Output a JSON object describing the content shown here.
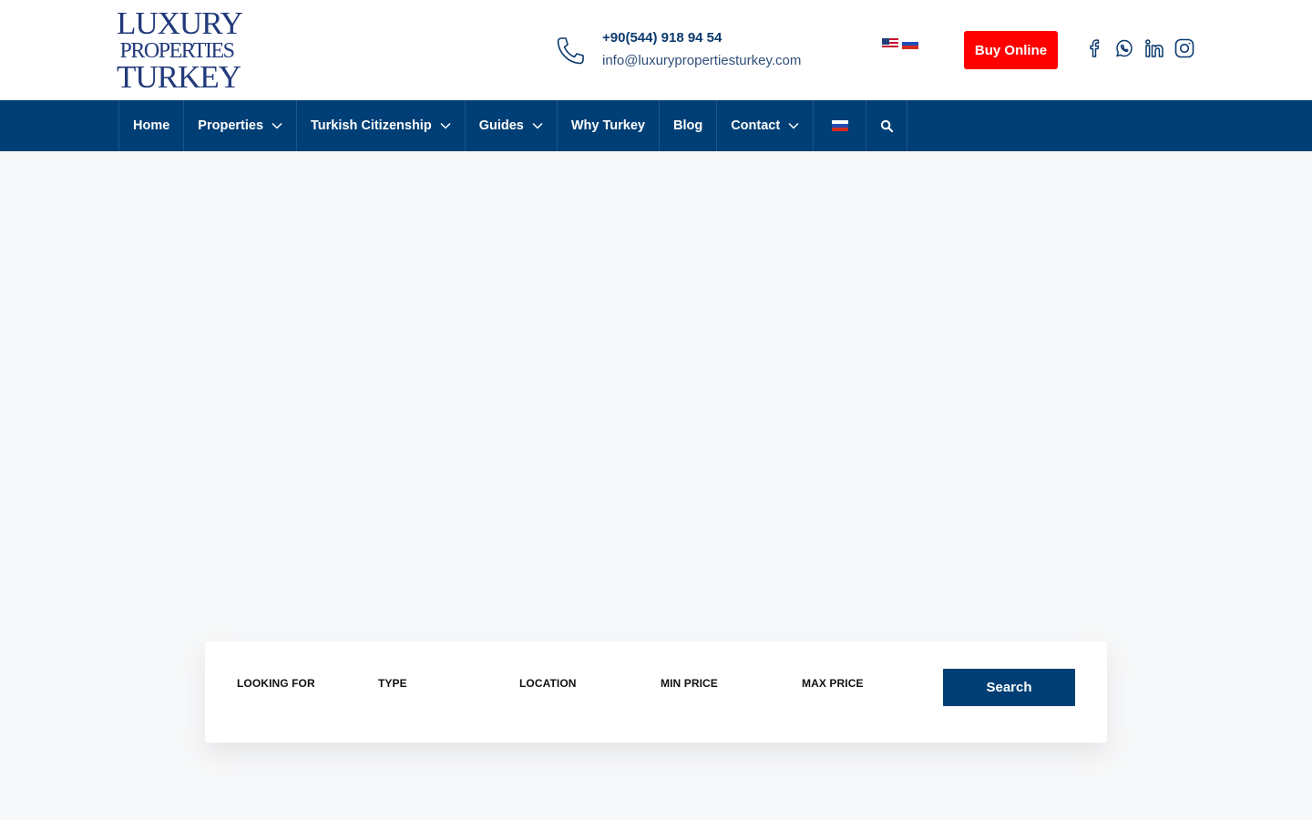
{
  "brand": {
    "logo_line1": "LUXURY",
    "logo_line2": "PROPERTIES",
    "logo_line3": "TURKEY",
    "logo_color": "#223a7a"
  },
  "header": {
    "phone": "+90(544) 918 94 54",
    "email": "info@luxurypropertiesturkey.com",
    "buy_label": "Buy Online",
    "languages": [
      "us-flag",
      "ru-flag"
    ],
    "social_icons": [
      "facebook-icon",
      "whatsapp-icon",
      "linkedin-icon",
      "instagram-icon"
    ]
  },
  "nav": {
    "items": [
      {
        "label": "Home",
        "dropdown": false
      },
      {
        "label": "Properties",
        "dropdown": true
      },
      {
        "label": "Turkish Citizenship",
        "dropdown": true
      },
      {
        "label": "Guides",
        "dropdown": true
      },
      {
        "label": "Why Turkey",
        "dropdown": false
      },
      {
        "label": "Blog",
        "dropdown": false
      },
      {
        "label": "Contact",
        "dropdown": true
      }
    ],
    "language_icon": "ru-flag",
    "search_icon": "search-icon"
  },
  "search": {
    "fields": {
      "looking_for": "LOOKING FOR",
      "type": "TYPE",
      "location": "LOCATION",
      "min_price": "MIN PRICE",
      "max_price": "MAX PRICE"
    },
    "button_label": "Search"
  },
  "colors": {
    "primary": "#003f75",
    "accent": "#ff0000",
    "page_bg": "#f7f8f9"
  }
}
